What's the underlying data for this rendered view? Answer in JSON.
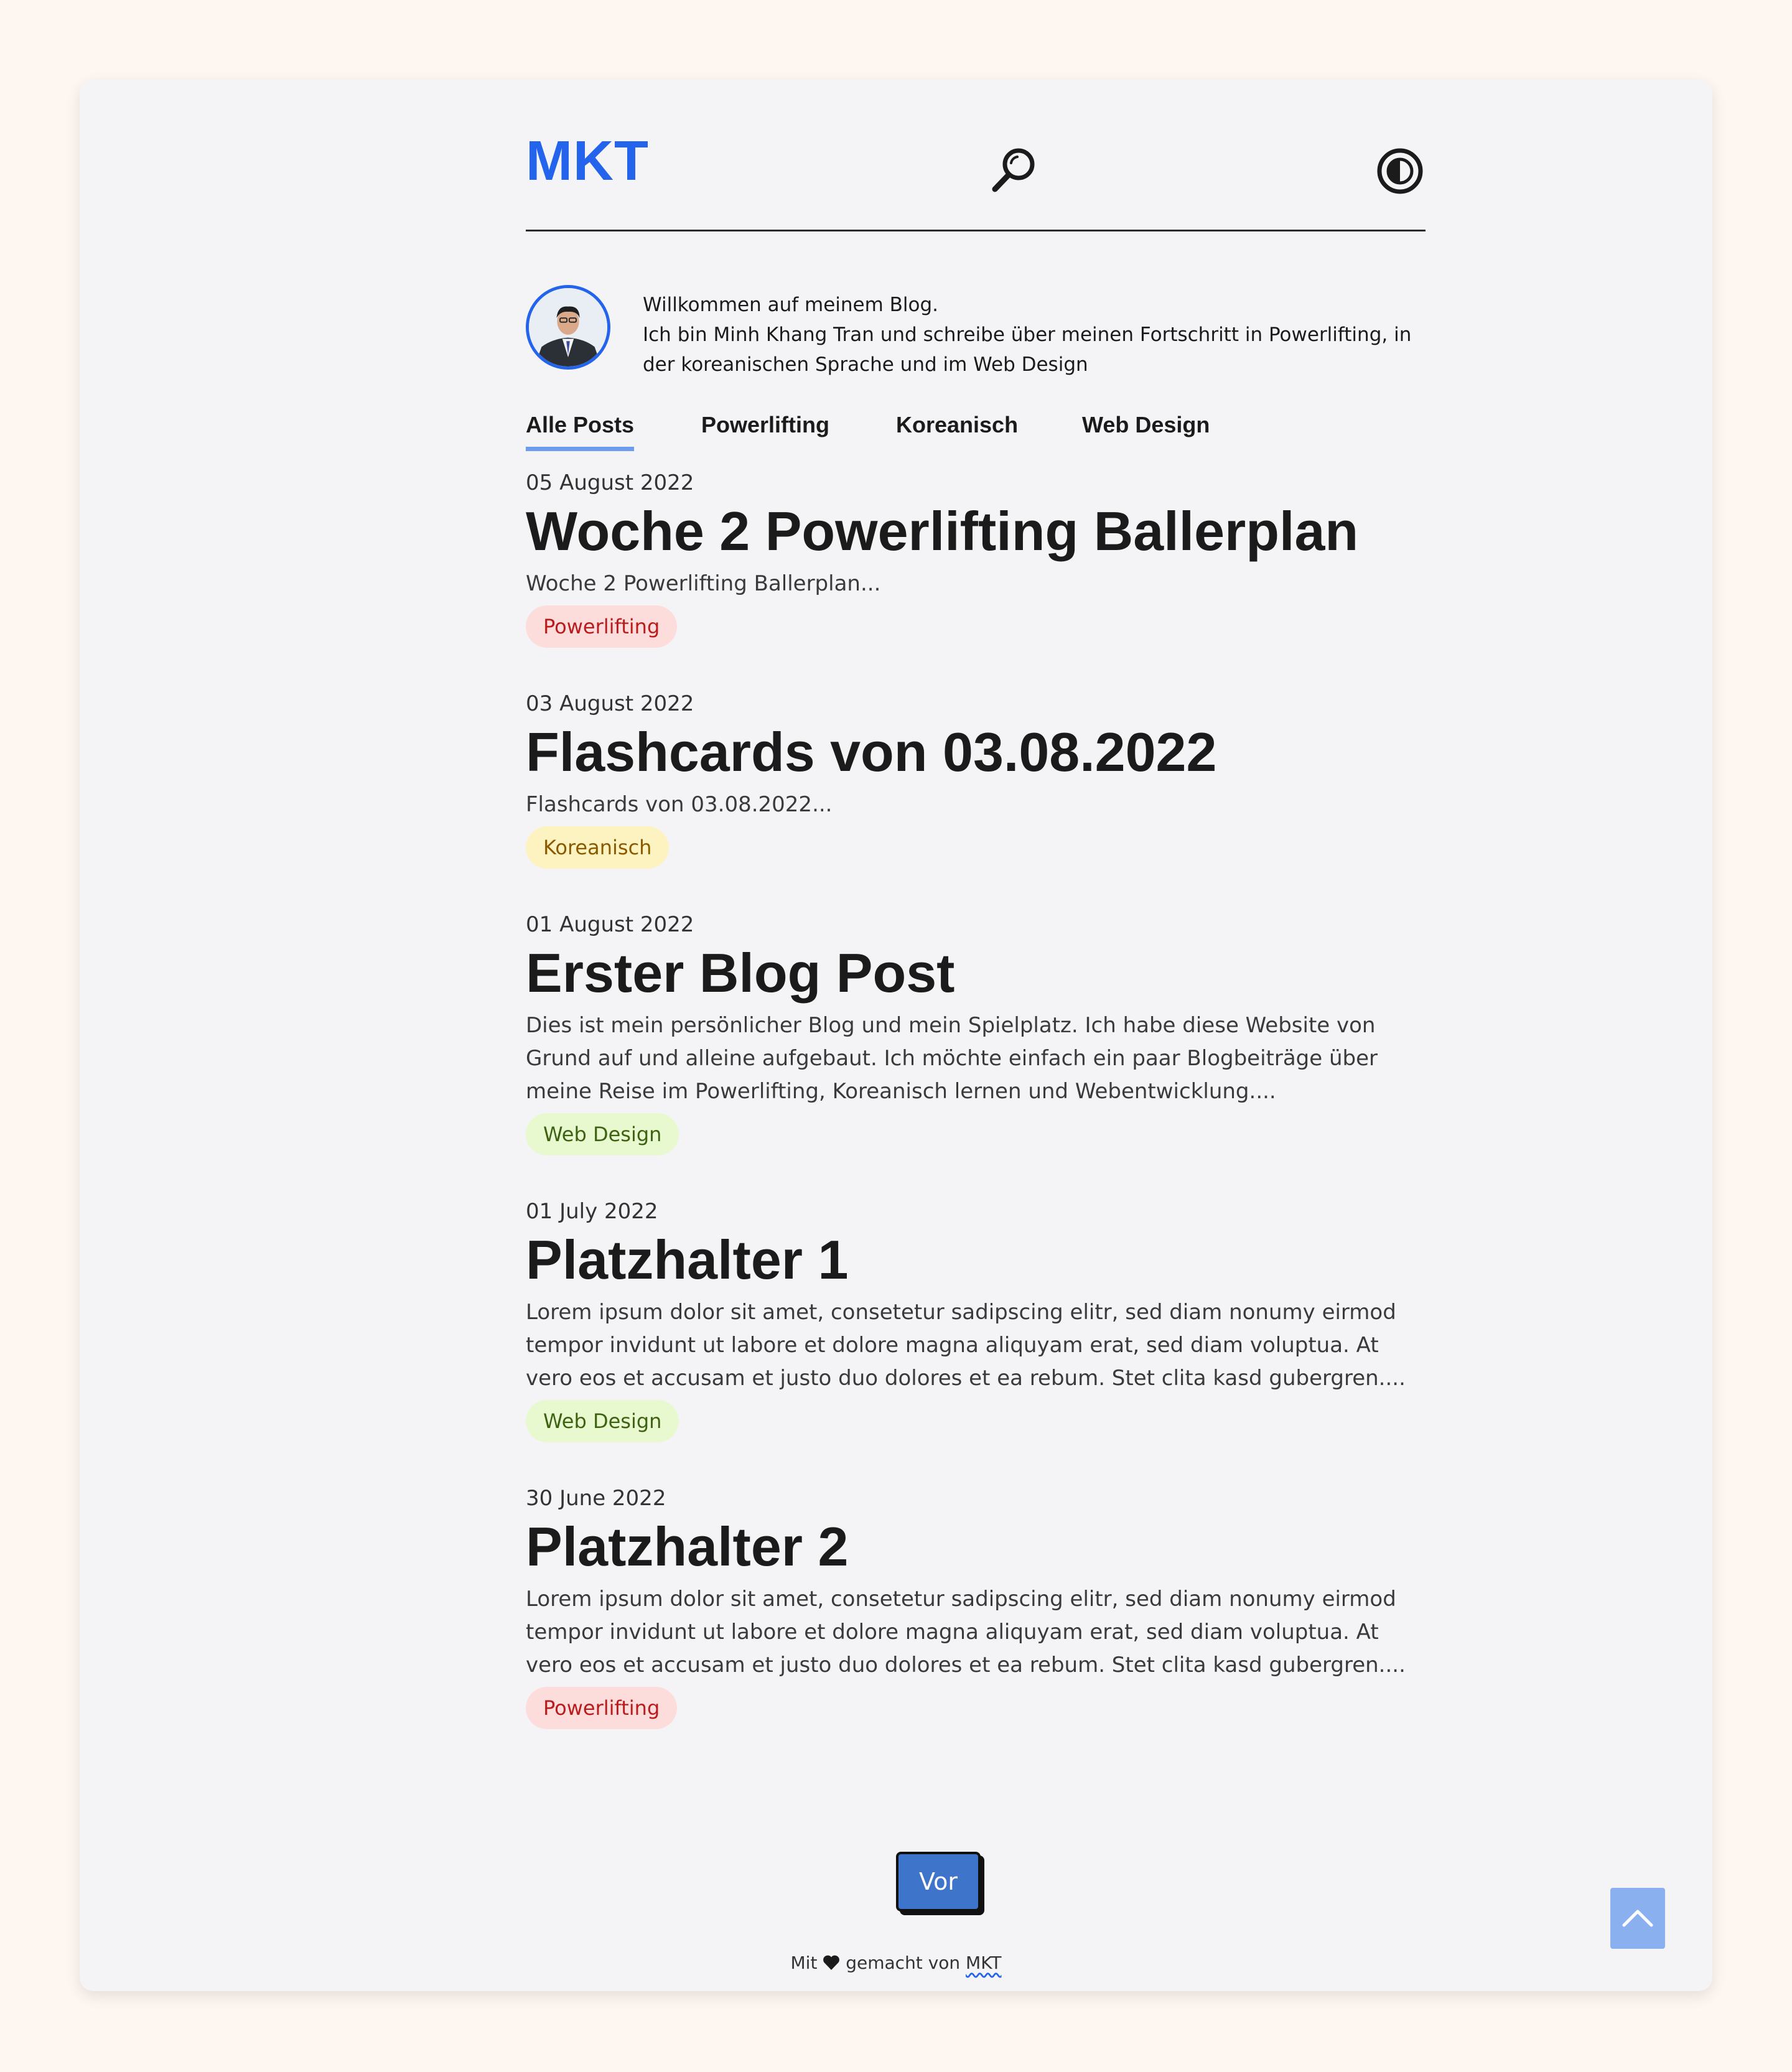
{
  "header": {
    "logo": "MKT"
  },
  "intro": {
    "line1": "Willkommen auf meinem Blog.",
    "line2": "Ich bin Minh Khang Tran und schreibe über meinen Fortschritt in Powerlifting, in der koreanischen Sprache und im Web Design"
  },
  "tabs": [
    {
      "label": "Alle Posts",
      "active": true
    },
    {
      "label": "Powerlifting",
      "active": false
    },
    {
      "label": "Koreanisch",
      "active": false
    },
    {
      "label": "Web Design",
      "active": false
    }
  ],
  "posts": [
    {
      "date": "05 August 2022",
      "title": "Woche 2 Powerlifting Ballerplan",
      "excerpt": "Woche 2 Powerlifting Ballerplan...",
      "tag": "Powerlifting"
    },
    {
      "date": "03 August 2022",
      "title": "Flashcards von 03.08.2022",
      "excerpt": "Flashcards von 03.08.2022...",
      "tag": "Koreanisch"
    },
    {
      "date": "01 August 2022",
      "title": "Erster Blog Post",
      "excerpt": "Dies ist mein persönlicher Blog und mein Spielplatz. Ich habe diese Website von Grund auf und alleine aufgebaut. Ich möchte einfach ein paar Blogbeiträge über meine Reise im Powerlifting, Koreanisch lernen und Webentwicklung....",
      "tag": "Web Design"
    },
    {
      "date": "01 July 2022",
      "title": "Platzhalter 1",
      "excerpt": "Lorem ipsum dolor sit amet, consetetur sadipscing elitr, sed diam nonumy eirmod tempor invidunt ut labore et dolore magna aliquyam erat, sed diam voluptua. At vero eos et accusam et justo duo dolores et ea rebum. Stet clita kasd gubergren....",
      "tag": "Web Design"
    },
    {
      "date": "30 June 2022",
      "title": "Platzhalter 2",
      "excerpt": "Lorem ipsum dolor sit amet, consetetur sadipscing elitr, sed diam nonumy eirmod tempor invidunt ut labore et dolore magna aliquyam erat, sed diam voluptua. At vero eos et accusam et justo duo dolores et ea rebum. Stet clita kasd gubergren....",
      "tag": "Powerlifting"
    }
  ],
  "pagination": {
    "next_label": "Vor"
  },
  "footer": {
    "prefix": "Mit",
    "middle": "gemacht von",
    "link": "MKT"
  },
  "colors": {
    "brand": "#2463eb",
    "page_background": "#fef6f0",
    "card_background": "#f4f4f6"
  },
  "icons": {
    "search": "search-icon",
    "theme": "theme-toggle-icon",
    "heart": "heart-icon",
    "scroll_top": "chevron-up-icon"
  }
}
